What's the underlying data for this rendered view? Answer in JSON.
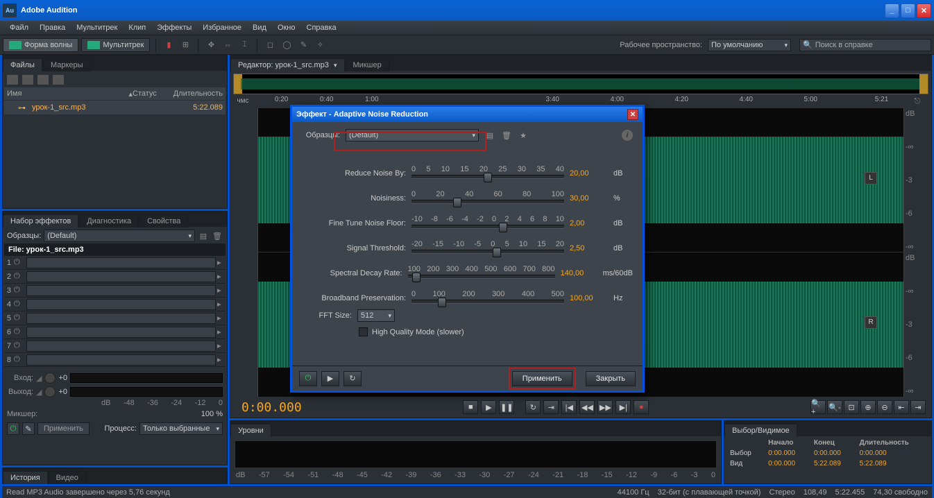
{
  "window": {
    "title": "Adobe Audition"
  },
  "menu": [
    "Файл",
    "Правка",
    "Мультитрек",
    "Клип",
    "Эффекты",
    "Избранное",
    "Вид",
    "Окно",
    "Справка"
  ],
  "toolbar": {
    "waveform_label": "Форма волны",
    "multitrack_label": "Мультитрек",
    "workspace_label": "Рабочее пространство:",
    "workspace_value": "По умолчанию",
    "search_placeholder": "Поиск в справке"
  },
  "files_panel": {
    "tab_files": "Файлы",
    "tab_markers": "Маркеры",
    "col_name": "Имя",
    "col_status": "Статус",
    "col_duration": "Длительность",
    "file_name": "урок-1_src.mp3",
    "file_duration": "5:22.089"
  },
  "effects_panel": {
    "tab_rack": "Набор эффектов",
    "tab_diag": "Диагностика",
    "tab_props": "Свойства",
    "presets_label": "Образцы:",
    "preset_value": "(Default)",
    "file_label": "File: урок-1_src.mp3",
    "slots": [
      "1",
      "2",
      "3",
      "4",
      "5",
      "6",
      "7",
      "8"
    ],
    "input_label": "Вход:",
    "output_label": "Выход:",
    "io_val": "+0",
    "db_ticks": [
      "dB",
      "-48",
      "-36",
      "-24",
      "-12",
      "0"
    ],
    "mix_label": "Микшер:",
    "mix_value": "100 %",
    "apply_btn": "Применить",
    "process_label": "Процесс:",
    "process_value": "Только выбранные"
  },
  "history_panel": {
    "tab_history": "История",
    "tab_video": "Видео"
  },
  "editor": {
    "tab_label": "Редактор: урок-1_src.mp3",
    "tab_mixer": "Микшер",
    "hms_label": "чмс",
    "ticks": [
      "0:20",
      "0:40",
      "1:00",
      "3:40",
      "4:00",
      "4:20",
      "4:40",
      "5:00",
      "5:21"
    ],
    "tick_pos": [
      3,
      10,
      17,
      45,
      55,
      65,
      75,
      85,
      96
    ],
    "right_db": [
      "dB",
      "-∞",
      "-3",
      "-6",
      "-∞",
      "dB",
      "-∞",
      "-3",
      "-6",
      "-∞"
    ],
    "timecode": "0:00.000"
  },
  "levels": {
    "tab": "Уровни",
    "ticks": [
      "dB",
      "-57",
      "-54",
      "-51",
      "-48",
      "-45",
      "-42",
      "-39",
      "-36",
      "-33",
      "-30",
      "-27",
      "-24",
      "-21",
      "-18",
      "-15",
      "-12",
      "-9",
      "-6",
      "-3",
      "0"
    ]
  },
  "selection": {
    "tab": "Выбор/Видимое",
    "h_start": "Начало",
    "h_end": "Конец",
    "h_dur": "Длительность",
    "r_sel": "Выбор",
    "r_view": "Вид",
    "sel_start": "0:00.000",
    "sel_end": "0:00.000",
    "sel_dur": "0:00.000",
    "view_start": "0:00.000",
    "view_end": "5:22.089",
    "view_dur": "5:22.089"
  },
  "status": {
    "msg": "Read MP3 Audio завершено через 5,76 секунд",
    "s1": "44100 Гц",
    "s2": "32-бит (с плавающей точкой)",
    "s3": "Стерео",
    "s4": "108,49",
    "s5": "5:22.455",
    "s6": "74,30 свободно"
  },
  "dialog": {
    "title": "Эффект - Adaptive Noise Reduction",
    "presets_label": "Образцы:",
    "preset_value": "(Default)",
    "params": {
      "reduce": {
        "label": "Reduce Noise By:",
        "scale": [
          "0",
          "5",
          "10",
          "15",
          "20",
          "25",
          "30",
          "35",
          "40"
        ],
        "value": "20,00",
        "unit": "dB",
        "pos": 50
      },
      "noisiness": {
        "label": "Noisiness:",
        "scale": [
          "0",
          "20",
          "40",
          "60",
          "80",
          "100"
        ],
        "value": "30,00",
        "unit": "%",
        "pos": 30
      },
      "floor": {
        "label": "Fine Tune Noise Floor:",
        "scale": [
          "-10",
          "-8",
          "-6",
          "-4",
          "-2",
          "0",
          "2",
          "4",
          "6",
          "8",
          "10"
        ],
        "value": "2,00",
        "unit": "dB",
        "pos": 60
      },
      "signal": {
        "label": "Signal Threshold:",
        "scale": [
          "-20",
          "-15",
          "-10",
          "-5",
          "0",
          "5",
          "10",
          "15",
          "20"
        ],
        "value": "2,50",
        "unit": "dB",
        "pos": 56
      },
      "decay": {
        "label": "Spectral Decay Rate:",
        "scale": [
          "100",
          "200",
          "300",
          "400",
          "500",
          "600",
          "700",
          "800"
        ],
        "value": "140,00",
        "unit": "ms/60dB",
        "pos": 6
      },
      "broadband": {
        "label": "Broadband Preservation:",
        "scale": [
          "0",
          "100",
          "200",
          "300",
          "400",
          "500"
        ],
        "value": "100,00",
        "unit": "Hz",
        "pos": 20
      }
    },
    "fft_label": "FFT Size:",
    "fft_value": "512",
    "hq_label": "High Quality Mode (slower)",
    "apply_btn": "Применить",
    "close_btn": "Закрыть"
  }
}
